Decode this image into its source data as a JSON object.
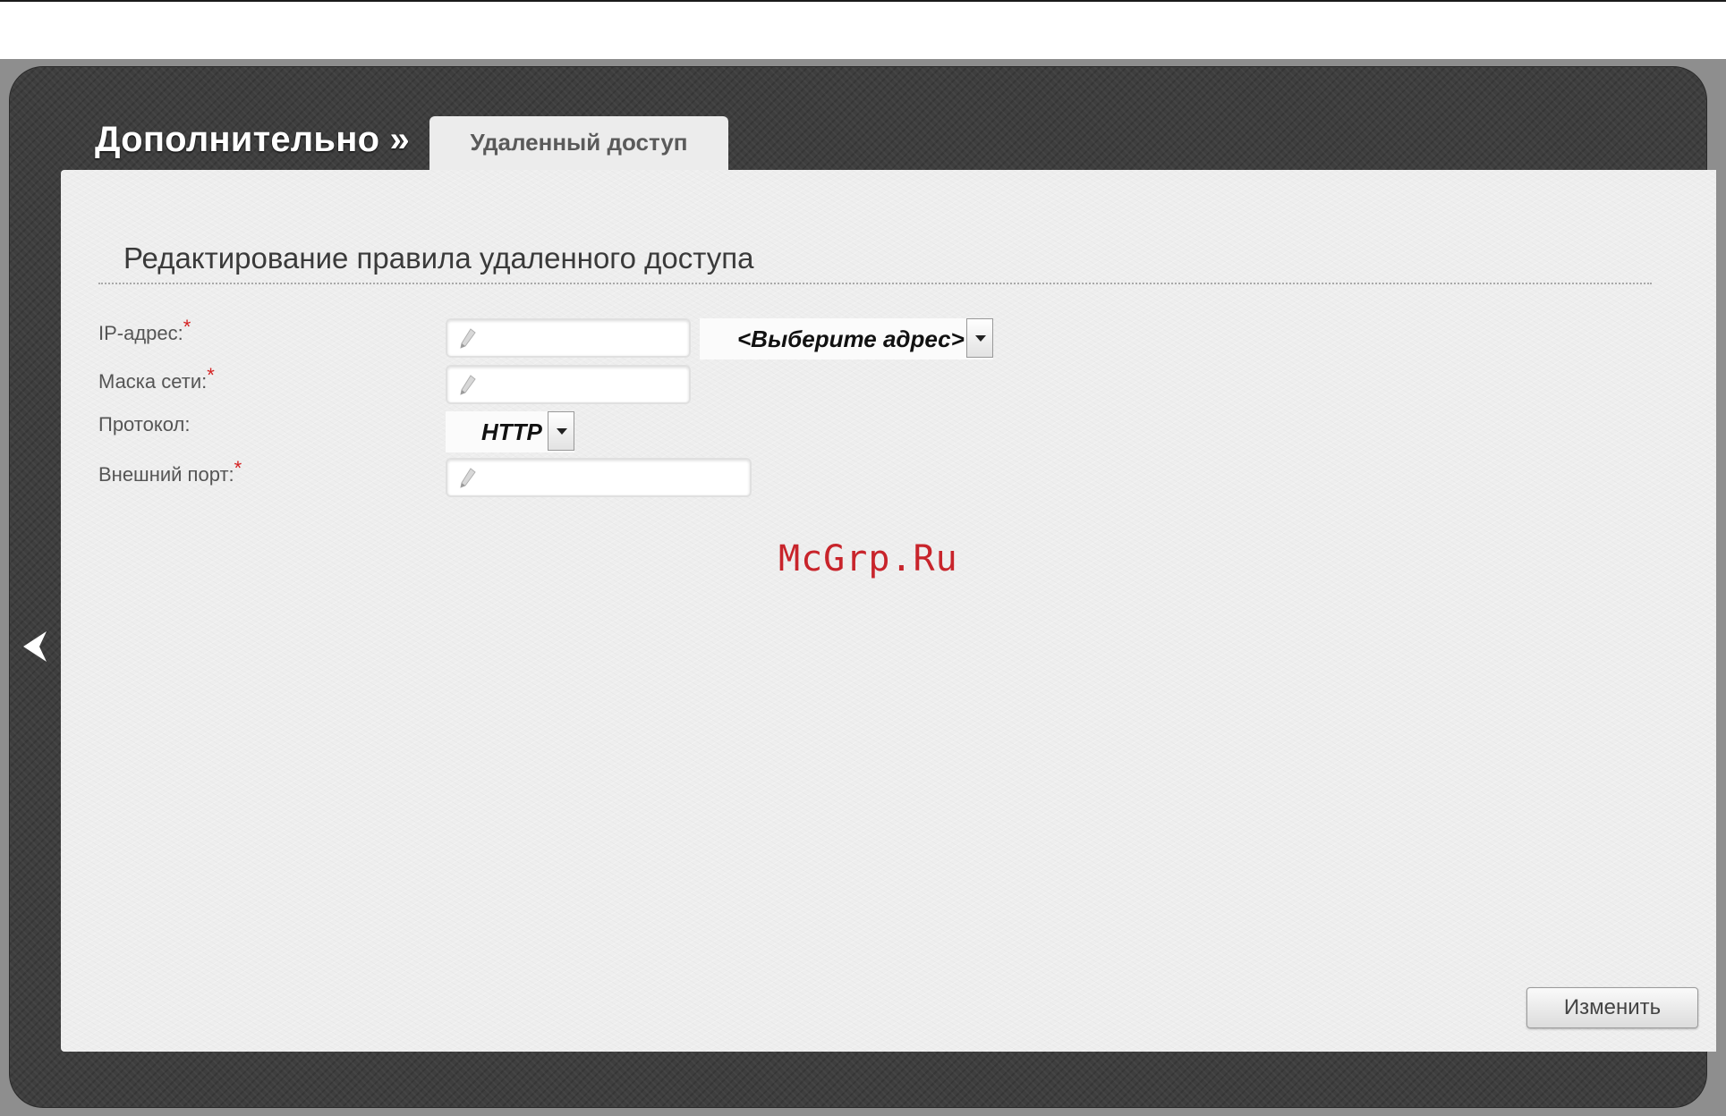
{
  "header": {
    "section_title": "Дополнительно »",
    "active_tab": "Удаленный доступ"
  },
  "form": {
    "heading": "Редактирование правила удаленного доступа",
    "fields": {
      "ip_address": {
        "label": "IP-адрес:",
        "required_mark": "*",
        "value": ""
      },
      "address_select": {
        "selected": "<Выберите адрес>"
      },
      "netmask": {
        "label": "Маска сети:",
        "required_mark": "*",
        "value": ""
      },
      "protocol": {
        "label": "Протокол:",
        "selected": "HTTP"
      },
      "external_port": {
        "label": "Внешний порт:",
        "required_mark": "*",
        "value": ""
      }
    }
  },
  "watermark": "McGrp.Ru",
  "actions": {
    "change_label": "Изменить"
  },
  "icons": {
    "edit": "pencil-icon",
    "back": "chevron-left-icon",
    "dropdown": "chevron-down-icon"
  },
  "colors": {
    "panel": "#3e3e3e",
    "content": "#eeeeee",
    "required": "#d42020",
    "watermark": "#c8242b"
  }
}
